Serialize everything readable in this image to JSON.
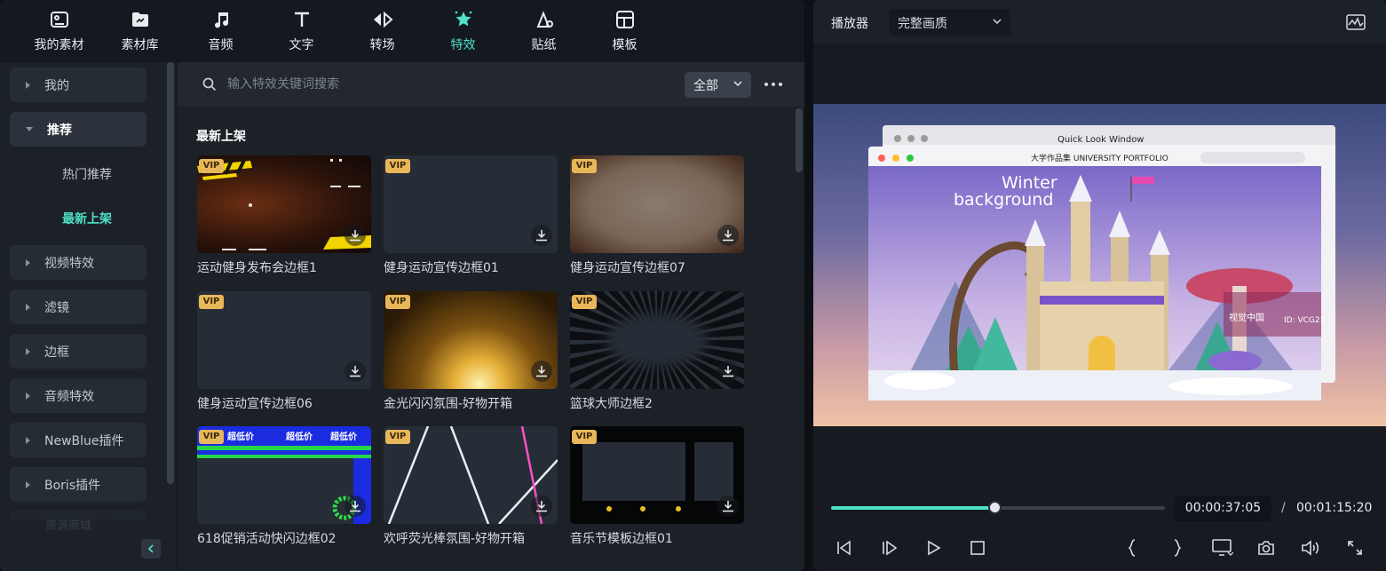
{
  "topnav": [
    {
      "label": "我的素材",
      "icon": "my-media-icon"
    },
    {
      "label": "素材库",
      "icon": "library-icon"
    },
    {
      "label": "音频",
      "icon": "music-note-icon"
    },
    {
      "label": "文字",
      "icon": "text-icon"
    },
    {
      "label": "转场",
      "icon": "transition-icon"
    },
    {
      "label": "特效",
      "icon": "effects-star-icon",
      "active": true
    },
    {
      "label": "贴纸",
      "icon": "sticker-icon"
    },
    {
      "label": "模板",
      "icon": "template-icon"
    }
  ],
  "sidebar": {
    "items": [
      {
        "label": "我的"
      },
      {
        "label": "推荐",
        "expanded": true
      },
      {
        "label": "视频特效"
      },
      {
        "label": "滤镜"
      },
      {
        "label": "边框"
      },
      {
        "label": "音频特效"
      },
      {
        "label": "NewBlue插件"
      },
      {
        "label": "Boris插件"
      }
    ],
    "subitems": [
      {
        "label": "热门推荐"
      },
      {
        "label": "最新上架",
        "active": true
      }
    ],
    "faded_label": "资源商城"
  },
  "search": {
    "placeholder": "输入特效关键词搜索",
    "filter": "全部"
  },
  "section_title": "最新上架",
  "vip_label": "VIP",
  "cards": [
    {
      "label": "运动健身发布会边框1",
      "vip": true
    },
    {
      "label": "健身运动宣传边框01",
      "vip": true
    },
    {
      "label": "健身运动宣传边框07",
      "vip": true
    },
    {
      "label": "健身运动宣传边框06",
      "vip": true
    },
    {
      "label": "金光闪闪氛围-好物开箱",
      "vip": true
    },
    {
      "label": "篮球大师边框2",
      "vip": true
    },
    {
      "label": "618促销活动快闪边框02",
      "vip": true
    },
    {
      "label": "欢呼荧光棒氛围-好物开箱",
      "vip": true
    },
    {
      "label": "音乐节模板边框01",
      "vip": true
    }
  ],
  "player": {
    "title": "播放器",
    "quality": "完整画质",
    "current_time": "00:00:37:05",
    "separator": "/",
    "total_time": "00:01:15:20",
    "progress": 0.49
  },
  "preview": {
    "window_back_title": "Quick Look Window",
    "window_front_title": "大学作品集 UNIVERSITY PORTFOLIO",
    "headline_1": "Winter",
    "headline_2": "background",
    "watermark": "视觉中国",
    "watermark_id": "ID: VCG21"
  },
  "colors": {
    "accent": "#4fe0c8",
    "vip": "#e8b75a",
    "panel": "#1c2128"
  }
}
